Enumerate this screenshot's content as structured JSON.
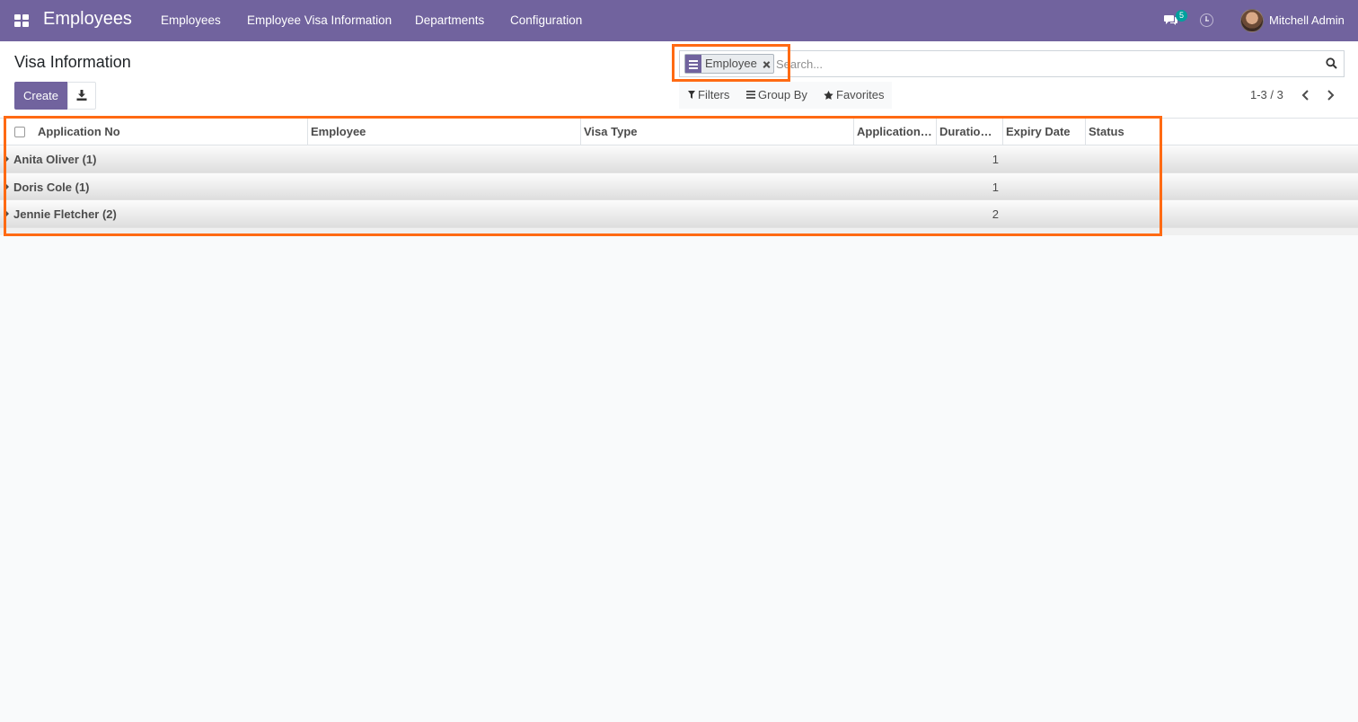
{
  "navbar": {
    "app_title": "Employees",
    "menu": [
      "Employees",
      "Employee Visa Information",
      "Departments",
      "Configuration"
    ],
    "messages_badge": "5",
    "user_name": "Mitchell Admin",
    "color": "#71639e"
  },
  "control_panel": {
    "title": "Visa Information",
    "create_label": "Create",
    "search": {
      "facet_label": "Employee",
      "placeholder": "Search..."
    },
    "options": {
      "filters": "Filters",
      "group_by": "Group By",
      "favorites": "Favorites"
    },
    "pager": "1-3 / 3"
  },
  "list": {
    "columns": [
      "Application No",
      "Employee",
      "Visa Type",
      "Application…",
      "Duratio…",
      "Expiry Date",
      "Status"
    ],
    "groups": [
      {
        "name": "Anita Oliver (1)",
        "count": "1"
      },
      {
        "name": "Doris Cole (1)",
        "count": "1"
      },
      {
        "name": "Jennie Fletcher (2)",
        "count": "2"
      }
    ]
  },
  "highlight_color": "#ff6a13"
}
